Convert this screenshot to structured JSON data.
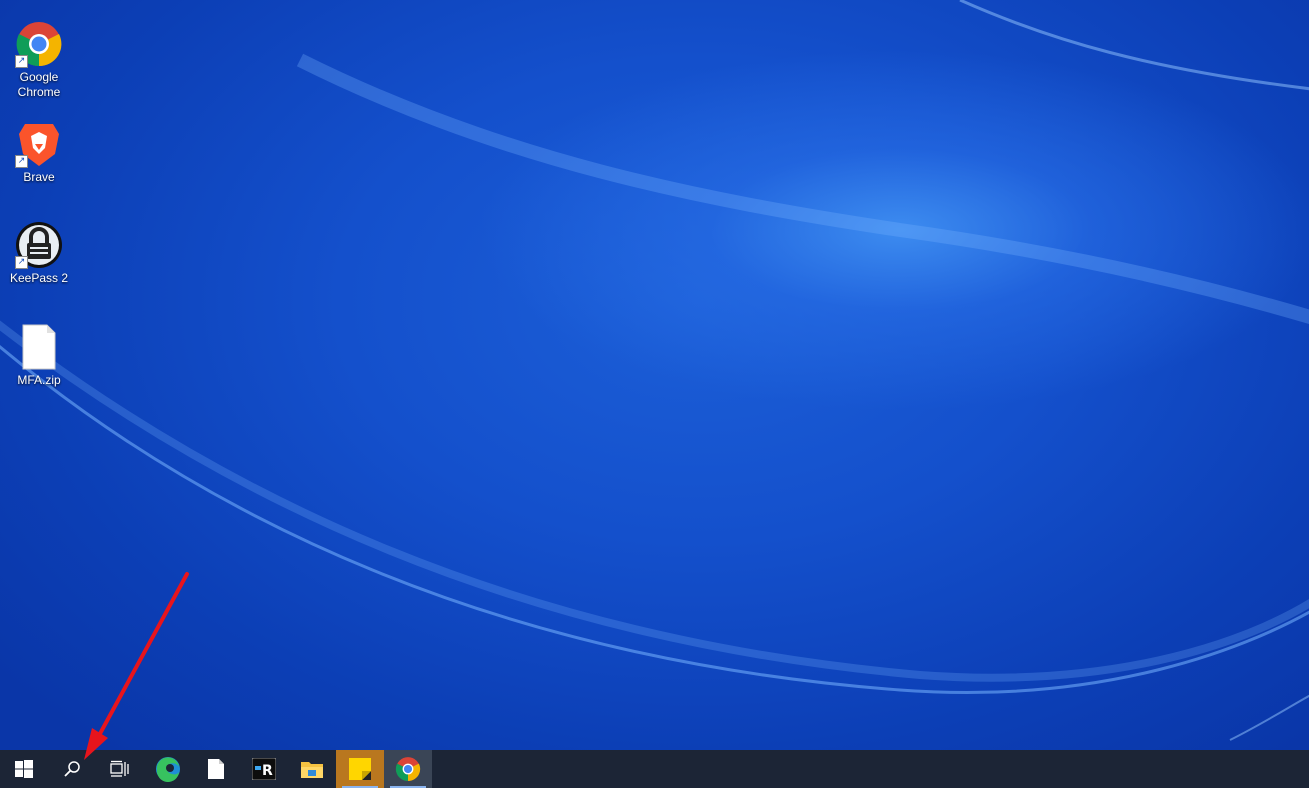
{
  "desktop": {
    "icons": [
      {
        "label_line1": "Google",
        "label_line2": "Chrome",
        "icon": "chrome-icon"
      },
      {
        "label_line1": "Brave",
        "label_line2": "",
        "icon": "brave-icon"
      },
      {
        "label_line1": "KeePass 2",
        "label_line2": "",
        "icon": "keepass-icon"
      },
      {
        "label_line1": "MFA.zip",
        "label_line2": "",
        "icon": "file-icon"
      }
    ],
    "background_color": "#1450cc"
  },
  "taskbar": {
    "background_color": "#1c2536",
    "buttons": [
      {
        "name": "start",
        "icon": "windows-icon"
      },
      {
        "name": "search",
        "icon": "search-icon"
      },
      {
        "name": "task-view",
        "icon": "task-view-icon"
      },
      {
        "name": "edge",
        "icon": "edge-icon"
      },
      {
        "name": "document",
        "icon": "file-icon"
      },
      {
        "name": "app-r",
        "icon": "app-r-icon"
      },
      {
        "name": "file-explorer",
        "icon": "folder-icon"
      },
      {
        "name": "sticky-notes",
        "icon": "sticky-notes-icon"
      },
      {
        "name": "chrome",
        "icon": "chrome-icon"
      }
    ]
  },
  "annotation": {
    "icon": "red-arrow-pointer",
    "color": "#e8141c"
  }
}
